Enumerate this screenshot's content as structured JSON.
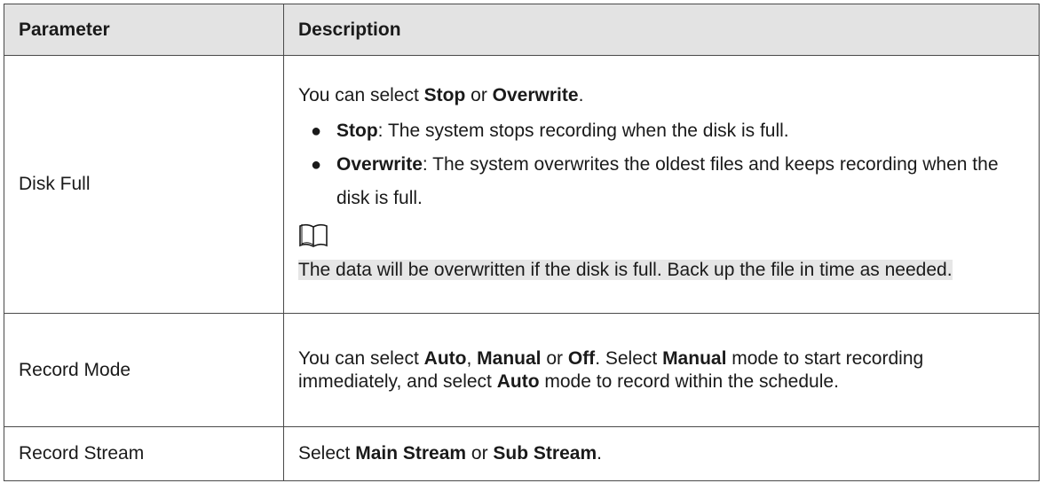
{
  "table": {
    "headers": {
      "parameter": "Parameter",
      "description": "Description"
    },
    "rows": {
      "disk_full": {
        "name": "Disk Full",
        "intro": {
          "t1": "You can select ",
          "b1": "Stop",
          "t2": " or ",
          "b2": "Overwrite",
          "t3": "."
        },
        "bullets": [
          {
            "bold": "Stop",
            "text": ": The system stops recording when the disk is full."
          },
          {
            "bold": "Overwrite",
            "text": ": The system overwrites the oldest files and keeps recording when the disk is full."
          }
        ],
        "note_icon": "book-note-icon",
        "note": "The data will be overwritten if the disk is full. Back up the file in time as needed."
      },
      "record_mode": {
        "name": "Record Mode",
        "t1": "You can select ",
        "b1": "Auto",
        "t2": ", ",
        "b2": "Manual",
        "t3": " or ",
        "b3": "Off",
        "t4": ". Select ",
        "b4": "Manual",
        "t5": " mode to start recording immediately, and select ",
        "b5": "Auto",
        "t6": " mode to record within the schedule."
      },
      "record_stream": {
        "name": "Record Stream",
        "t1": "Select ",
        "b1": "Main Stream",
        "t2": " or ",
        "b2": "Sub Stream",
        "t3": "."
      }
    }
  }
}
